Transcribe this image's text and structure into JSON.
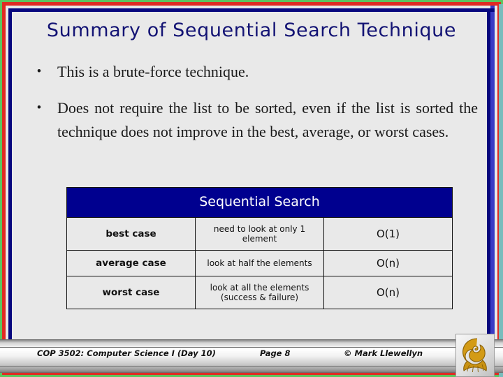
{
  "slide": {
    "title": "Summary of Sequential Search Technique",
    "bullet_marker": "•",
    "bullets": [
      "This is a brute-force technique.",
      "Does not require the list to be sorted, even if the list is sorted the technique does not improve in the best, average, or worst cases."
    ]
  },
  "table": {
    "header": "Sequential Search",
    "rows": [
      {
        "case": "best case",
        "description": "need to look at only 1 element",
        "complexity": "O(1)"
      },
      {
        "case": "average case",
        "description": "look at half the elements",
        "complexity": "O(n)"
      },
      {
        "case": "worst case",
        "description": "look at all the elements (success & failure)",
        "complexity": "O(n)"
      }
    ]
  },
  "footer": {
    "course": "COP 3502: Computer Science I  (Day 10)",
    "page": "Page 8",
    "copyright": "© Mark Llewellyn",
    "logo_name": "ucf-pegasus-logo"
  },
  "colors": {
    "title": "#131374",
    "table_header_bg": "#00008f",
    "frame_green": "#5ec45e",
    "frame_red": "#e02a22",
    "frame_navy": "#07077e",
    "logo_gold": "#d39b16"
  }
}
